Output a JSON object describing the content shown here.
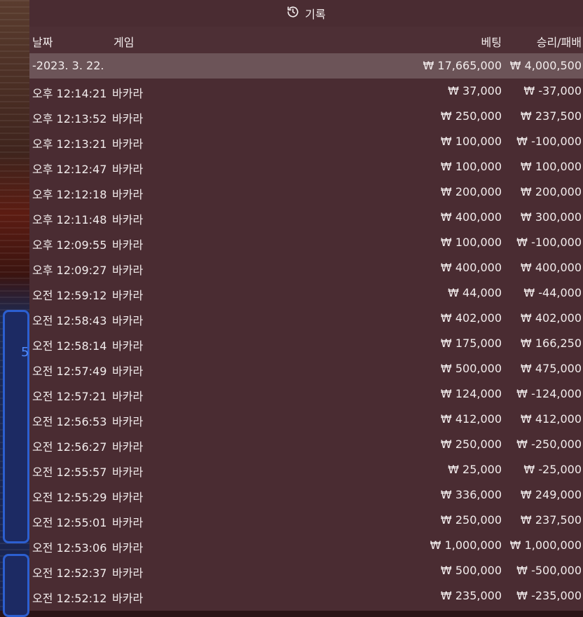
{
  "title": "기록",
  "columns": {
    "date": "날짜",
    "game": "게임",
    "bet": "베팅",
    "result": "승리/패배"
  },
  "summary": {
    "date": "-2023. 3. 22.",
    "bet": "₩ 17,665,000",
    "result": "₩ 4,000,500"
  },
  "rows": [
    {
      "time": "오후 12:14:21",
      "game": "바카라",
      "bet": "₩ 37,000",
      "result": "₩ -37,000"
    },
    {
      "time": "오후 12:13:52",
      "game": "바카라",
      "bet": "₩ 250,000",
      "result": "₩ 237,500"
    },
    {
      "time": "오후 12:13:21",
      "game": "바카라",
      "bet": "₩ 100,000",
      "result": "₩ -100,000"
    },
    {
      "time": "오후 12:12:47",
      "game": "바카라",
      "bet": "₩ 100,000",
      "result": "₩ 100,000"
    },
    {
      "time": "오후 12:12:18",
      "game": "바카라",
      "bet": "₩ 200,000",
      "result": "₩ 200,000"
    },
    {
      "time": "오후 12:11:48",
      "game": "바카라",
      "bet": "₩ 400,000",
      "result": "₩ 300,000"
    },
    {
      "time": "오후 12:09:55",
      "game": "바카라",
      "bet": "₩ 100,000",
      "result": "₩ -100,000"
    },
    {
      "time": "오후 12:09:27",
      "game": "바카라",
      "bet": "₩ 400,000",
      "result": "₩ 400,000"
    },
    {
      "time": "오전 12:59:12",
      "game": "바카라",
      "bet": "₩ 44,000",
      "result": "₩ -44,000"
    },
    {
      "time": "오전 12:58:43",
      "game": "바카라",
      "bet": "₩ 402,000",
      "result": "₩ 402,000"
    },
    {
      "time": "오전 12:58:14",
      "game": "바카라",
      "bet": "₩ 175,000",
      "result": "₩ 166,250"
    },
    {
      "time": "오전 12:57:49",
      "game": "바카라",
      "bet": "₩ 500,000",
      "result": "₩ 475,000"
    },
    {
      "time": "오전 12:57:21",
      "game": "바카라",
      "bet": "₩ 124,000",
      "result": "₩ -124,000"
    },
    {
      "time": "오전 12:56:53",
      "game": "바카라",
      "bet": "₩ 412,000",
      "result": "₩ 412,000"
    },
    {
      "time": "오전 12:56:27",
      "game": "바카라",
      "bet": "₩ 250,000",
      "result": "₩ -250,000"
    },
    {
      "time": "오전 12:55:57",
      "game": "바카라",
      "bet": "₩ 25,000",
      "result": "₩ -25,000"
    },
    {
      "time": "오전 12:55:29",
      "game": "바카라",
      "bet": "₩ 336,000",
      "result": "₩ 249,000"
    },
    {
      "time": "오전 12:55:01",
      "game": "바카라",
      "bet": "₩ 250,000",
      "result": "₩ 237,500"
    },
    {
      "time": "오전 12:53:06",
      "game": "바카라",
      "bet": "₩ 1,000,000",
      "result": "₩ 1,000,000"
    },
    {
      "time": "오전 12:52:37",
      "game": "바카라",
      "bet": "₩ 500,000",
      "result": "₩ -500,000"
    },
    {
      "time": "오전 12:52:12",
      "game": "바카라",
      "bet": "₩ 235,000",
      "result": "₩ -235,000"
    }
  ],
  "background": {
    "partial_number": "5"
  },
  "colors": {
    "panel": "#4a2c32",
    "date_row": "#6c5458",
    "text": "#f2ecec"
  },
  "icons": {
    "title": "history-icon"
  }
}
